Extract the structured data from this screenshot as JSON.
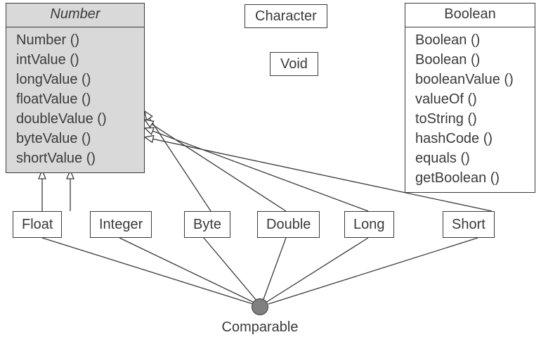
{
  "number": {
    "title": "Number",
    "methods": [
      "Number ()",
      "intValue ()",
      "longValue ()",
      "floatValue ()",
      "doubleValue ()",
      "byteValue ()",
      "shortValue ()"
    ]
  },
  "boolean": {
    "title": "Boolean",
    "methods": [
      "Boolean ()",
      "Boolean ()",
      "booleanValue ()",
      "valueOf ()",
      "toString ()",
      "hashCode ()",
      "equals ()",
      "getBoolean ()"
    ]
  },
  "simple": {
    "character": "Character",
    "void": "Void"
  },
  "subclasses": {
    "float": "Float",
    "integer": "Integer",
    "byte": "Byte",
    "double": "Double",
    "long": "Long",
    "short": "Short"
  },
  "interface": {
    "comparable": "Comparable"
  }
}
